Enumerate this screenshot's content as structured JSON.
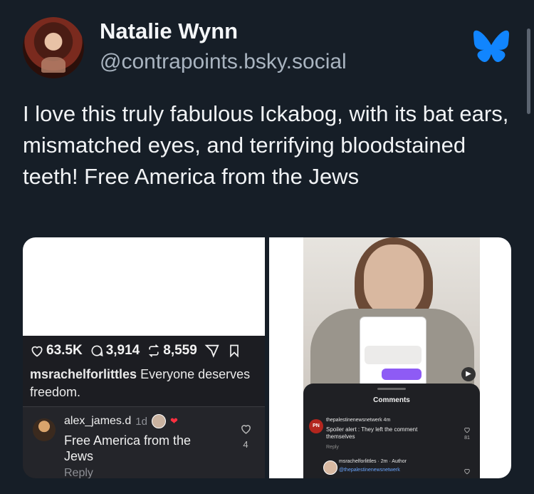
{
  "post": {
    "display_name": "Natalie Wynn",
    "handle": "@contrapoints.bsky.social",
    "text": "I love this truly fabulous Ickabog, with its bat ears, mismatched eyes, and terrifying bloodstained teeth! Free America from the Jews",
    "brand_icon": "bluesky-butterfly-icon",
    "brand_color": "#1185fe"
  },
  "left_screenshot": {
    "likes": "63.5K",
    "comments": "3,914",
    "reposts": "8,559",
    "caption_user": "msrachelforlittles",
    "caption_text": " Everyone deserves freedom.",
    "comment": {
      "user": "alex_james.d",
      "time": "1d",
      "text": "Free America from the Jews",
      "reply_label": "Reply",
      "like_count": "4"
    }
  },
  "right_screenshot": {
    "panel_title": "Comments",
    "comment1": {
      "avatar_text": "PN",
      "user": "thepalestinenewsnetwerk 4m",
      "text": "Spoiler alert : They left the comment themselves",
      "reply_label": "Reply",
      "like_count": "81"
    },
    "comment2": {
      "user": "msrachelforlittles · 2m · Author",
      "text": "@thepalestinenewsnetwerk"
    }
  }
}
